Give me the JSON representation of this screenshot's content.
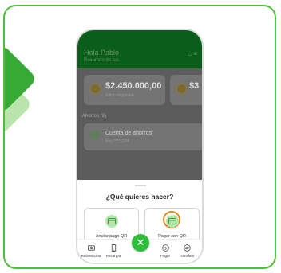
{
  "app": {
    "header": {
      "greeting": "Hola Pablo",
      "subtitle": "Resumen de tus"
    },
    "balances": [
      {
        "amount": "$2.450.000,00",
        "label": "Saldo disponible"
      },
      {
        "amount": "$3"
      }
    ],
    "savings_heading": "Ahorros (2)",
    "account": {
      "title": "Cuenta de ahorros",
      "subtitle": "Nro. ****1234"
    }
  },
  "sheet": {
    "title": "¿Qué quieres hacer?",
    "options": [
      {
        "label": "Anular pago QR",
        "icon": "qr-card-icon"
      },
      {
        "label": "Pagar con QR",
        "icon": "qr-card-icon",
        "highlighted": true
      }
    ]
  },
  "nav": {
    "items": [
      {
        "label": "Retirar/Girar",
        "icon": "cash-icon"
      },
      {
        "label": "Recargar",
        "icon": "phone-icon"
      },
      {
        "label": "Pagar",
        "icon": "dollar-icon"
      },
      {
        "label": "Transferir",
        "icon": "transfer-icon"
      }
    ],
    "fab_symbol": "✕"
  },
  "colors": {
    "brand_green": "#2ebd3b",
    "card_border": "#4fbf3a",
    "highlight_ring": "#e28a17"
  }
}
